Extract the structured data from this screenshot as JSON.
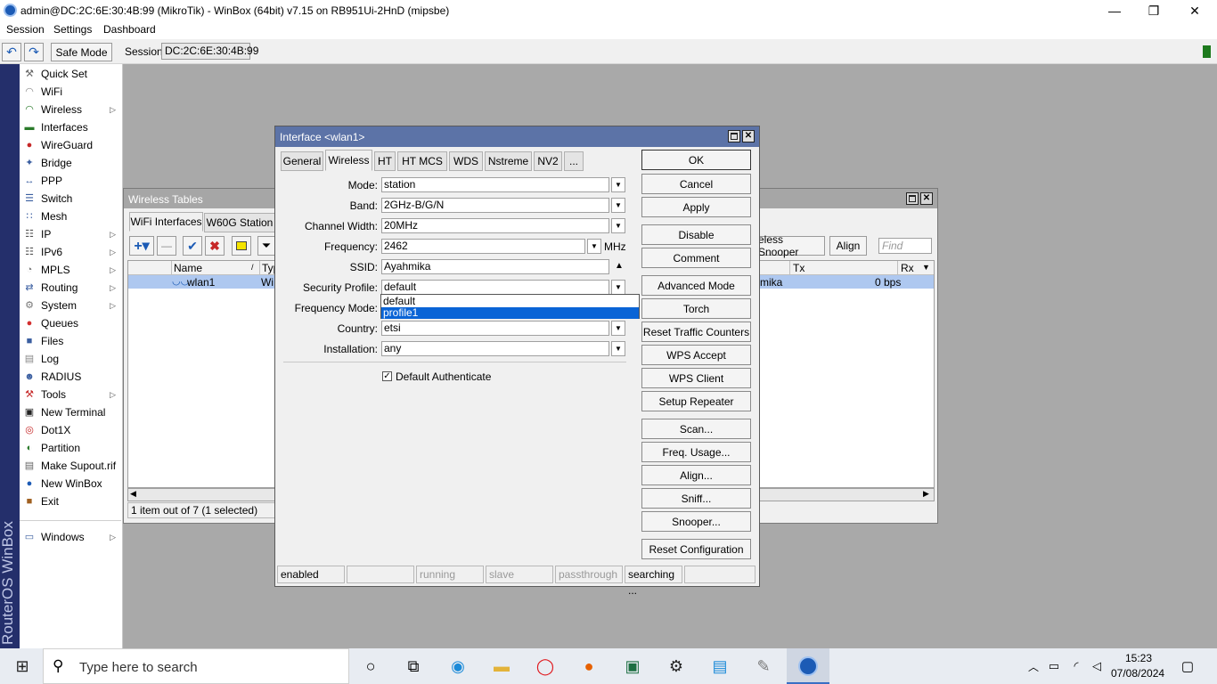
{
  "window": {
    "title": "admin@DC:2C:6E:30:4B:99 (MikroTik) - WinBox (64bit) v7.15 on RB951Ui-2HnD (mipsbe)",
    "minimize": "—",
    "maximize": "❐",
    "close": "✕"
  },
  "menu": [
    "Session",
    "Settings",
    "Dashboard"
  ],
  "toolbar": {
    "undo": "↶",
    "redo": "↷",
    "safe_mode": "Safe Mode",
    "session_label": "Session:",
    "session_value": "DC:2C:6E:30:4B:99"
  },
  "brand": "RouterOS WinBox",
  "sidebar": [
    {
      "label": "Quick Set",
      "icon": "⚒",
      "color": "#666666",
      "arrow": false
    },
    {
      "label": "WiFi",
      "icon": "◠",
      "color": "#888888",
      "arrow": false
    },
    {
      "label": "Wireless",
      "icon": "◠",
      "color": "#2a7a2a",
      "arrow": true
    },
    {
      "label": "Interfaces",
      "icon": "▬",
      "color": "#2a7a2a",
      "arrow": false
    },
    {
      "label": "WireGuard",
      "icon": "●",
      "color": "#c62828",
      "arrow": false
    },
    {
      "label": "Bridge",
      "icon": "✦",
      "color": "#3a5ea0",
      "arrow": false
    },
    {
      "label": "PPP",
      "icon": "↔",
      "color": "#3a5ea0",
      "arrow": false
    },
    {
      "label": "Switch",
      "icon": "☰",
      "color": "#3a5ea0",
      "arrow": false
    },
    {
      "label": "Mesh",
      "icon": "∷",
      "color": "#3a5ea0",
      "arrow": false
    },
    {
      "label": "IP",
      "icon": "☷",
      "color": "#555555",
      "arrow": true
    },
    {
      "label": "IPv6",
      "icon": "☷",
      "color": "#555555",
      "arrow": true
    },
    {
      "label": "MPLS",
      "icon": "◔",
      "color": "#777777",
      "arrow": true
    },
    {
      "label": "Routing",
      "icon": "⇄",
      "color": "#3a5ea0",
      "arrow": true
    },
    {
      "label": "System",
      "icon": "⚙",
      "color": "#777777",
      "arrow": true
    },
    {
      "label": "Queues",
      "icon": "●",
      "color": "#d32f2f",
      "arrow": false
    },
    {
      "label": "Files",
      "icon": "■",
      "color": "#3a5ea0",
      "arrow": false
    },
    {
      "label": "Log",
      "icon": "▤",
      "color": "#888888",
      "arrow": false
    },
    {
      "label": "RADIUS",
      "icon": "☻",
      "color": "#3a5ea0",
      "arrow": false
    },
    {
      "label": "Tools",
      "icon": "⚒",
      "color": "#c62828",
      "arrow": true
    },
    {
      "label": "New Terminal",
      "icon": "▣",
      "color": "#222222",
      "arrow": false
    },
    {
      "label": "Dot1X",
      "icon": "◎",
      "color": "#c62828",
      "arrow": false
    },
    {
      "label": "Partition",
      "icon": "◐",
      "color": "#2a7a2a",
      "arrow": false
    },
    {
      "label": "Make Supout.rif",
      "icon": "▤",
      "color": "#666666",
      "arrow": false
    },
    {
      "label": "New WinBox",
      "icon": "●",
      "color": "#1c5bb5",
      "arrow": false
    },
    {
      "label": "Exit",
      "icon": "■",
      "color": "#a06020",
      "arrow": false
    },
    {
      "label": "Windows",
      "icon": "▭",
      "color": "#3a5ea0",
      "arrow": true
    }
  ],
  "wireless_tables": {
    "title": "Wireless Tables",
    "tabs": [
      "WiFi Interfaces",
      "W60G Station"
    ],
    "right_buttons": [
      "eless Snooper",
      "Align"
    ],
    "find_placeholder": "Find",
    "columns": {
      "name": "Name",
      "type": "Typ",
      "tx": "Tx",
      "rx": "Rx"
    },
    "row": {
      "name": "wlan1",
      "type": "Wi",
      "left_text": "mika",
      "tx": "0 bps"
    },
    "status": "1 item out of 7 (1 selected)"
  },
  "dialog": {
    "title": "Interface <wlan1>",
    "tabs": [
      "General",
      "Wireless",
      "HT",
      "HT MCS",
      "WDS",
      "Nstreme",
      "NV2",
      "..."
    ],
    "active_tab": "Wireless",
    "fields": {
      "mode": {
        "label": "Mode:",
        "value": "station"
      },
      "band": {
        "label": "Band:",
        "value": "2GHz-B/G/N"
      },
      "channel_width": {
        "label": "Channel Width:",
        "value": "20MHz"
      },
      "frequency": {
        "label": "Frequency:",
        "value": "2462",
        "unit": "MHz"
      },
      "ssid": {
        "label": "SSID:",
        "value": "Ayahmika"
      },
      "security_profile": {
        "label": "Security Profile:",
        "value": "default"
      },
      "frequency_mode": {
        "label": "Frequency Mode:"
      },
      "country": {
        "label": "Country:",
        "value": "etsi"
      },
      "installation": {
        "label": "Installation:",
        "value": "any"
      }
    },
    "security_profile_options": [
      "default",
      "profile1"
    ],
    "selected_option": "profile1",
    "default_authenticate": {
      "label": "Default Authenticate",
      "checked": true
    },
    "buttons": [
      "OK",
      "Cancel",
      "Apply",
      "Disable",
      "Comment",
      "Advanced Mode",
      "Torch",
      "Reset Traffic Counters",
      "WPS Accept",
      "WPS Client",
      "Setup Repeater",
      "Scan...",
      "Freq. Usage...",
      "Align...",
      "Sniff...",
      "Snooper...",
      "Reset Configuration"
    ],
    "statusbar": [
      "enabled",
      "",
      "running",
      "slave",
      "passthrough",
      "searching ...",
      ""
    ]
  },
  "taskbar": {
    "search_placeholder": "Type here to search",
    "time": "15:23",
    "date": "07/08/2024"
  },
  "colors": {
    "dialog_title": "#5c73a7",
    "selection": "#0a64d6",
    "row_selected": "#aec8f0"
  }
}
